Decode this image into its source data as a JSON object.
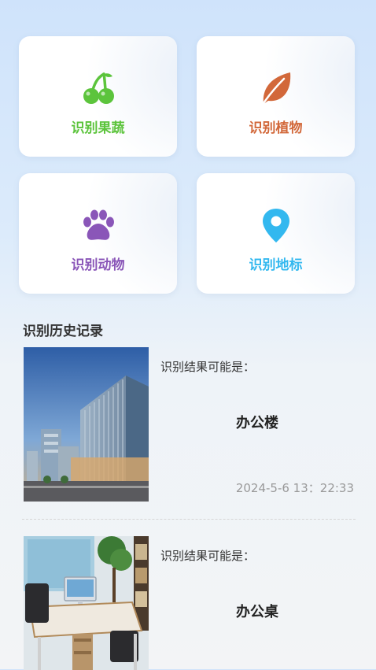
{
  "features": [
    {
      "label": "识别果蔬",
      "icon": "cherry-icon",
      "color": "#5cc43c"
    },
    {
      "label": "识别植物",
      "icon": "leaf-icon",
      "color": "#d2683a"
    },
    {
      "label": "识别动物",
      "icon": "paw-icon",
      "color": "#8a56b8"
    },
    {
      "label": "识别地标",
      "icon": "location-pin-icon",
      "color": "#33b8ef"
    }
  ],
  "history": {
    "title": "识别历史记录",
    "items": [
      {
        "prefix": "识别结果可能是：",
        "result": "办公楼",
        "time": "2024-5-6 13：22:33",
        "image": "office-building-photo"
      },
      {
        "prefix": "识别结果可能是：",
        "result": "办公桌",
        "time": "",
        "image": "office-desk-photo"
      }
    ]
  }
}
